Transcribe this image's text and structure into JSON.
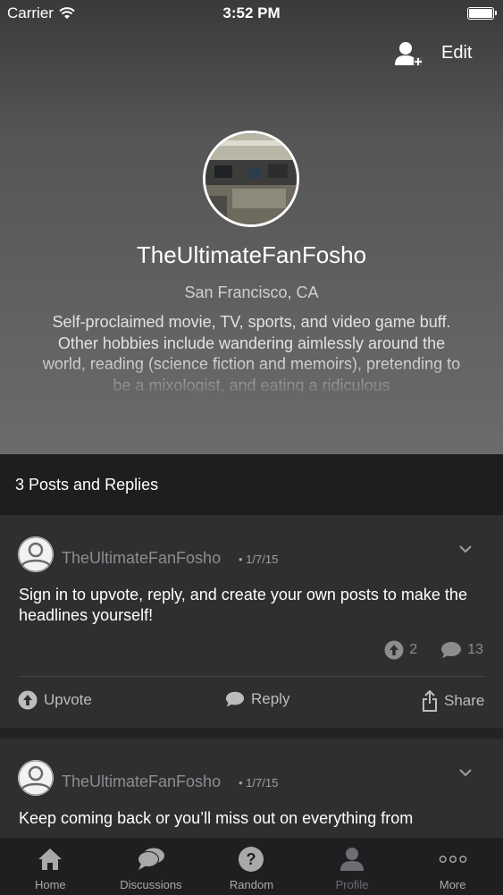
{
  "status_bar": {
    "carrier": "Carrier",
    "time": "3:52 PM"
  },
  "header": {
    "edit_label": "Edit",
    "username": "TheUltimateFanFosho",
    "location": "San Francisco, CA",
    "bio": "Self-proclaimed movie, TV, sports, and video game buff. Other hobbies include wandering aimlessly around the world, reading (science fiction and memoirs), pretending to be a mixologist, and eating a ridiculous"
  },
  "section": {
    "title": "3 Posts and Replies"
  },
  "posts": [
    {
      "author": "TheUltimateFanFosho",
      "date": "• 1/7/15",
      "text": "Sign in to upvote, reply, and create your own posts to make the headlines yourself!",
      "upvotes": "2",
      "replies": "13",
      "actions": {
        "upvote": "Upvote",
        "reply": "Reply",
        "share": "Share"
      }
    },
    {
      "author": "TheUltimateFanFosho",
      "date": "• 1/7/15",
      "text": "Keep coming back or you’ll miss out on everything from"
    }
  ],
  "tabbar": {
    "items": [
      {
        "label": "Home",
        "icon": "home-icon"
      },
      {
        "label": "Discussions",
        "icon": "chat-bubbles-icon"
      },
      {
        "label": "Random",
        "icon": "question-icon"
      },
      {
        "label": "Profile",
        "icon": "person-icon"
      },
      {
        "label": "More",
        "icon": "more-dots-icon"
      }
    ],
    "active": "Profile"
  }
}
